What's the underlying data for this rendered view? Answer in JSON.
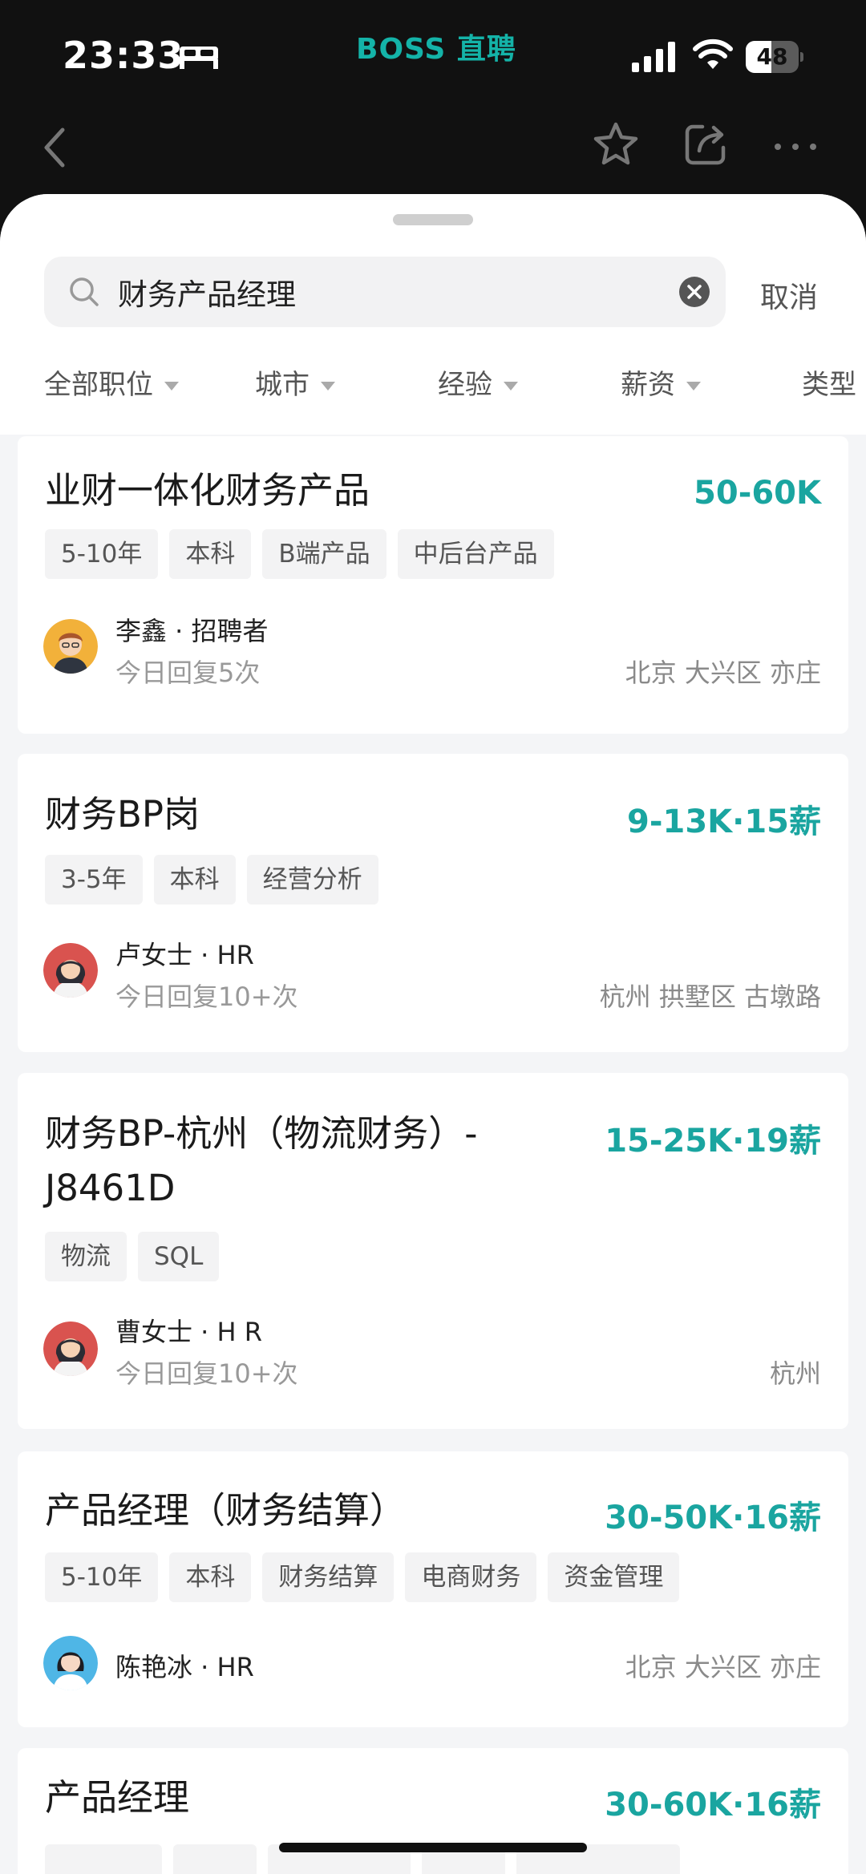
{
  "status_bar": {
    "time": "23:33",
    "brand": "BOSS 直聘",
    "battery": "48",
    "battery_level": 0.48
  },
  "search": {
    "query": "财务产品经理",
    "cancel_label": "取消"
  },
  "filters": [
    "全部职位",
    "城市",
    "经验",
    "薪资",
    "类型"
  ],
  "jobs": [
    {
      "title": "业财一体化财务产品",
      "salary": "50-60K",
      "tags": [
        "5-10年",
        "本科",
        "B端产品",
        "中后台产品"
      ],
      "recruiter": "李鑫 · 招聘者",
      "reply": "今日回复5次",
      "location": "北京 大兴区 亦庄"
    },
    {
      "title": "财务BP岗",
      "salary": "9-13K·15薪",
      "tags": [
        "3-5年",
        "本科",
        "经营分析"
      ],
      "recruiter": "卢女士 · HR",
      "reply": "今日回复10+次",
      "location": "杭州 拱墅区 古墩路"
    },
    {
      "title_line1": "财务BP-杭州（物流财务）-",
      "title_line2": "J8461D",
      "salary": "15-25K·19薪",
      "tags": [
        "物流",
        "SQL"
      ],
      "recruiter": "曹女士 · H R",
      "reply": "今日回复10+次",
      "location": "杭州"
    },
    {
      "title": "产品经理（财务结算）",
      "salary": "30-50K·16薪",
      "tags": [
        "5-10年",
        "本科",
        "财务结算",
        "电商财务",
        "资金管理"
      ],
      "recruiter": "陈艳冰 · HR",
      "location": "北京 大兴区 亦庄"
    },
    {
      "title": "产品经理",
      "salary": "30-60K·16薪"
    }
  ],
  "colors": {
    "accent": "#1aa5a0",
    "brand": "#14b3a8",
    "background": "#f4f5f7"
  }
}
